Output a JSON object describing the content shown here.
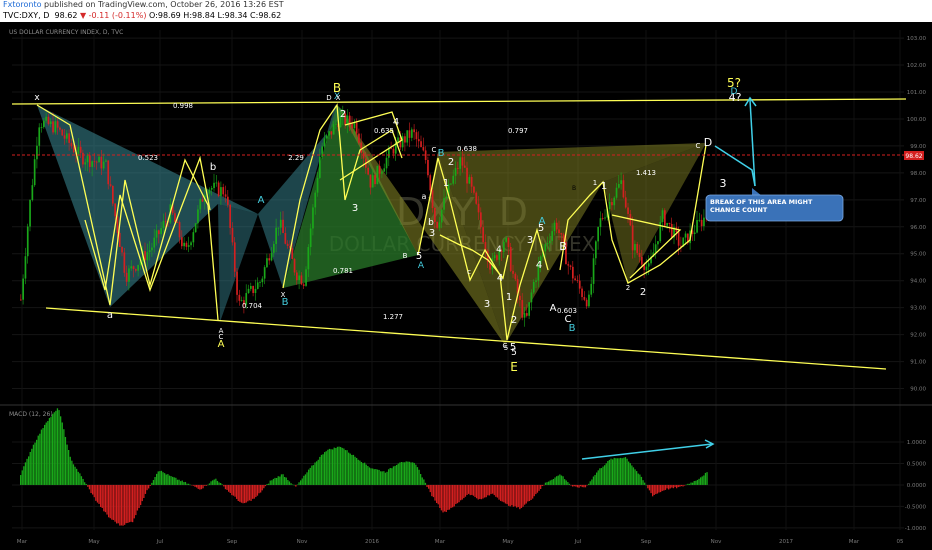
{
  "header": {
    "publisher": "Fxtoronto",
    "published_text": "published on TradingView.com, October 26, 2016 13:26 EST",
    "symbol": "TVC:DXY, D",
    "price": "98.62",
    "change": "▼ -0.11 (-0.11%)",
    "ohlc": "O:98.69 H:98.84 L:98.34 C:98.62"
  },
  "chart_data": {
    "type": "candlestick",
    "title": "US DOLLAR CURRENCY INDEX, D, TVC",
    "watermark": [
      "DXY, D",
      "DOLLAR CURRENCY INDEX"
    ],
    "x_labels": [
      "Mar",
      "May",
      "Jul",
      "Sep",
      "Nov",
      "2016",
      "Mar",
      "May",
      "Jul",
      "Sep",
      "Nov",
      "2017",
      "Mar",
      "05"
    ],
    "y_ticks": [
      "103.00",
      "102.00",
      "101.00",
      "100.00",
      "99.00",
      "98.00",
      "97.00",
      "96.00",
      "95.00",
      "94.00",
      "93.00",
      "92.00",
      "91.00",
      "90.00"
    ],
    "ylim": [
      89.5,
      103.3
    ],
    "last_price": "98.62",
    "macd": {
      "label": "MACD (12, 26)",
      "y_ticks": [
        "1.0000",
        "0.5000",
        "0.0000",
        "-0.5000",
        "-1.0000"
      ],
      "ylim": [
        -1.05,
        1.7
      ]
    },
    "price_path": [
      [
        0,
        93.3
      ],
      [
        8,
        96.5
      ],
      [
        18,
        99.9
      ],
      [
        35,
        99.7
      ],
      [
        60,
        98.6
      ],
      [
        85,
        98.3
      ],
      [
        105,
        94.2
      ],
      [
        130,
        95.2
      ],
      [
        150,
        96.6
      ],
      [
        165,
        95.0
      ],
      [
        185,
        97.5
      ],
      [
        205,
        97.3
      ],
      [
        218,
        93.1
      ],
      [
        240,
        94.0
      ],
      [
        258,
        96.2
      ],
      [
        275,
        94.3
      ],
      [
        283,
        94.0
      ],
      [
        300,
        98.9
      ],
      [
        318,
        100.0
      ],
      [
        335,
        99.8
      ],
      [
        350,
        97.6
      ],
      [
        372,
        98.9
      ],
      [
        392,
        99.5
      ],
      [
        406,
        98.4
      ],
      [
        415,
        96.0
      ],
      [
        430,
        97.6
      ],
      [
        440,
        98.5
      ],
      [
        452,
        97.2
      ],
      [
        470,
        94.5
      ],
      [
        484,
        95.6
      ],
      [
        497,
        93.4
      ],
      [
        505,
        92.4
      ],
      [
        512,
        93.8
      ],
      [
        523,
        95.2
      ],
      [
        535,
        96.2
      ],
      [
        548,
        94.5
      ],
      [
        560,
        93.6
      ],
      [
        568,
        93.2
      ],
      [
        578,
        96.1
      ],
      [
        590,
        97.0
      ],
      [
        601,
        97.7
      ],
      [
        612,
        95.3
      ],
      [
        628,
        94.4
      ],
      [
        642,
        96.4
      ],
      [
        660,
        95.3
      ],
      [
        678,
        96.1
      ],
      [
        690,
        96.6
      ],
      [
        700,
        97.9
      ],
      [
        707,
        98.6
      ]
    ],
    "macd_values": [
      [
        0,
        0.25
      ],
      [
        12,
        0.9
      ],
      [
        25,
        1.45
      ],
      [
        38,
        1.8
      ],
      [
        50,
        0.6
      ],
      [
        62,
        0.15
      ],
      [
        75,
        -0.35
      ],
      [
        88,
        -0.75
      ],
      [
        100,
        -0.95
      ],
      [
        112,
        -0.85
      ],
      [
        125,
        -0.2
      ],
      [
        138,
        0.35
      ],
      [
        150,
        0.2
      ],
      [
        165,
        0.05
      ],
      [
        180,
        -0.1
      ],
      [
        195,
        0.15
      ],
      [
        210,
        -0.2
      ],
      [
        222,
        -0.45
      ],
      [
        235,
        -0.3
      ],
      [
        250,
        0.1
      ],
      [
        262,
        0.25
      ],
      [
        275,
        -0.05
      ],
      [
        290,
        0.4
      ],
      [
        305,
        0.8
      ],
      [
        320,
        0.9
      ],
      [
        335,
        0.65
      ],
      [
        350,
        0.4
      ],
      [
        365,
        0.3
      ],
      [
        380,
        0.55
      ],
      [
        395,
        0.5
      ],
      [
        410,
        -0.2
      ],
      [
        423,
        -0.65
      ],
      [
        436,
        -0.45
      ],
      [
        448,
        -0.2
      ],
      [
        460,
        -0.35
      ],
      [
        472,
        -0.2
      ],
      [
        485,
        -0.45
      ],
      [
        500,
        -0.55
      ],
      [
        512,
        -0.3
      ],
      [
        525,
        0.05
      ],
      [
        540,
        0.25
      ],
      [
        552,
        -0.05
      ],
      [
        565,
        -0.05
      ],
      [
        578,
        0.35
      ],
      [
        590,
        0.6
      ],
      [
        605,
        0.65
      ],
      [
        620,
        0.2
      ],
      [
        632,
        -0.25
      ],
      [
        645,
        -0.1
      ],
      [
        660,
        -0.05
      ],
      [
        675,
        0.1
      ],
      [
        690,
        0.35
      ],
      [
        700,
        0.6
      ],
      [
        707,
        0.7
      ]
    ]
  },
  "annotations": {
    "ratios": [
      "0.998",
      "0.523",
      "2.29",
      "0.635",
      "0.638",
      "0.797",
      "1.413",
      "0.781",
      "0.704",
      "1.277",
      "0.603"
    ],
    "wave_labels": [
      "x",
      "a",
      "b",
      "C",
      "A",
      "B",
      "B",
      "X",
      "D",
      "X",
      "2",
      "3",
      "4",
      "2",
      "3",
      "1",
      "5",
      "4",
      "5",
      "A",
      "B",
      "C",
      "a",
      "b",
      "c",
      "1",
      "2",
      "3",
      "4",
      "5",
      "1",
      "2",
      "3",
      "4",
      "5",
      "A",
      "A",
      "B",
      "B",
      "C",
      "1",
      "2",
      "C",
      "D",
      "3",
      "4?",
      "5?",
      "D",
      "E",
      "C",
      "A",
      "A",
      "B",
      "X",
      "B",
      "5"
    ],
    "callout_text": "BREAK OF THIS AREA MIGHT CHANGE COUNT"
  },
  "colors": {
    "background": "#000000",
    "candle_up": "#1aa81a",
    "candle_down": "#d42020",
    "pattern_teal": "#3a8a96",
    "pattern_olive": "#8a8a26",
    "trendline": "#ffff55",
    "price_line": "#d42020",
    "callout": "#3a72b8",
    "arrow": "#40d0e8"
  }
}
